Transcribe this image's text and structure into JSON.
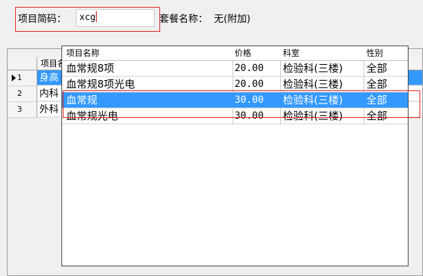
{
  "form": {
    "code_label": "项目简码：",
    "code_value": "xcg",
    "package_label": "套餐名称：",
    "package_value": "无(附加)"
  },
  "grid": {
    "header_name": "项目名",
    "rows": [
      {
        "num": "1",
        "name": "身高",
        "selected": true
      },
      {
        "num": "2",
        "name": "内科",
        "selected": false
      },
      {
        "num": "3",
        "name": "外科",
        "selected": false
      }
    ]
  },
  "popup": {
    "columns": [
      "项目名称",
      "价格",
      "科室",
      "性别"
    ],
    "rows": [
      {
        "name": "血常规8项",
        "price": "20.00",
        "dept": "检验科(三楼)",
        "gender": "全部",
        "selected": false
      },
      {
        "name": "血常规8项光电",
        "price": "20.00",
        "dept": "检验科(三楼)",
        "gender": "全部",
        "selected": false
      },
      {
        "name": "血常规",
        "price": "30.00",
        "dept": "检验科(三楼)",
        "gender": "全部",
        "selected": true
      },
      {
        "name": "血常规光电",
        "price": "30.00",
        "dept": "检验科(三楼)",
        "gender": "全部",
        "selected": false
      }
    ]
  },
  "colors": {
    "selection": "#3399ff",
    "highlight_box": "#e81c1c"
  }
}
